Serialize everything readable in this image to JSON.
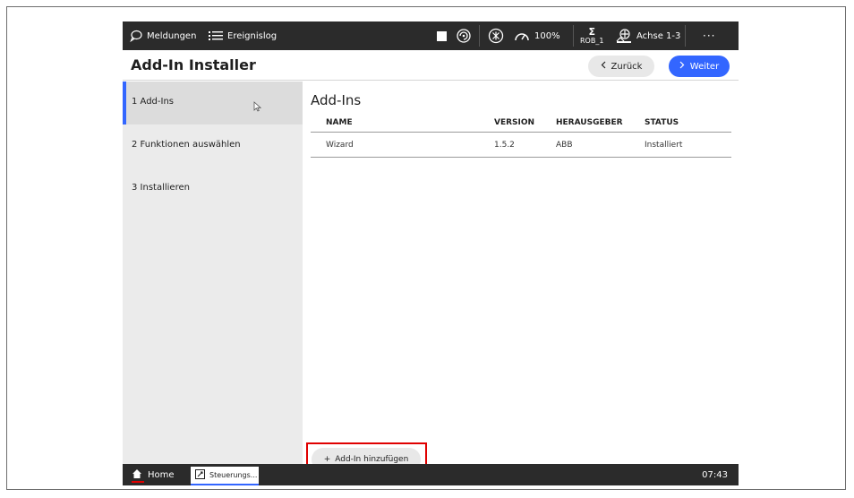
{
  "topbar": {
    "messages_label": "Meldungen",
    "eventlog_label": "Ereignislog",
    "speed": "100%",
    "robot_symbol": "Σ",
    "robot": "ROB_1",
    "axes": "Achse 1-3",
    "more": "···"
  },
  "header": {
    "title": "Add-In Installer",
    "back_label": "Zurück",
    "next_label": "Weiter",
    "accent": "#3366ff"
  },
  "sidebar": {
    "steps": [
      {
        "label": "1  Add-Ins"
      },
      {
        "label": "2  Funktionen auswählen"
      },
      {
        "label": "3  Installieren"
      }
    ]
  },
  "main": {
    "title": "Add-Ins",
    "columns": [
      "NAME",
      "VERSION",
      "HERAUSGEBER",
      "STATUS"
    ],
    "rows": [
      {
        "name": "Wizard",
        "version": "1.5.2",
        "publisher": "ABB",
        "status": "Installiert"
      }
    ],
    "add_button_label": "Add-In hinzufügen",
    "add_button_icon": "+"
  },
  "taskbar": {
    "home_label": "Home",
    "app_tab_label": "Steuerungs...",
    "clock": "07:43"
  },
  "colors": {
    "highlight": "#e00000",
    "bar_dark": "#2b2b2b"
  }
}
